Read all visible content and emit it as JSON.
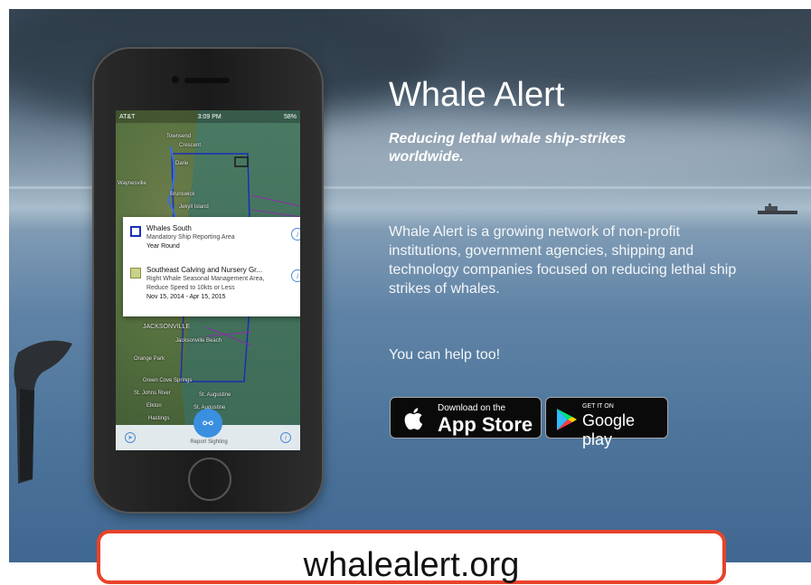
{
  "app": {
    "title": "Whale Alert",
    "tagline": "Reducing lethal whale ship-strikes worldwide.",
    "description": "Whale Alert is a growing network of non-profit institutions, government agencies, shipping and technology companies focused on reducing lethal ship strikes of whales.",
    "cta": "You can help too!"
  },
  "badges": {
    "apple_small": "Download on the",
    "apple_big": "App Store",
    "google_small": "GET IT ON",
    "google_big": "Google play"
  },
  "phone": {
    "statusbar": {
      "carrier": "AT&T",
      "time": "3:09 PM",
      "battery": "58%"
    },
    "popup": {
      "row1_title": "Whales South",
      "row1_line2": "Mandatory Ship Reporting Area",
      "row1_line3": "Year Round",
      "row2_title": "Southeast Calving and Nursery Gr...",
      "row2_line2": "Right Whale Seasonal Management Area,",
      "row2_line3": "Reduce Speed to 10kts or Less",
      "row2_line4": "Nov 15, 2014 - Apr 15, 2015",
      "row1_color": "#1a2fb8",
      "row2_color": "#c9d18a"
    },
    "map_labels": {
      "townsend": "Townsend",
      "crescent": "Crescent",
      "darien": "Darie",
      "brunswick": "Brunswick",
      "jekyll": "Jekyll Island",
      "waynesville": "Waynesville",
      "jacksonville": "JACKSONVILLE",
      "jax_beach": "Jacksonville Beach",
      "orange_park": "Orange Park",
      "green_cove": "Green Cove Springs",
      "st_aug": "St. Augustine",
      "elkton": "Elkton",
      "st_aug2": "St. Augustine",
      "hastings": "Hastings",
      "st_johns": "St. Johns River"
    },
    "bottom": {
      "report": "Report Sighting"
    }
  },
  "footer": {
    "url": "whalealert.org"
  },
  "colors": {
    "accent_red": "#e8422a",
    "zone_blue": "#1a2fb8",
    "zone_purple": "#8a2fa8",
    "ios_blue": "#3a8fe0"
  }
}
